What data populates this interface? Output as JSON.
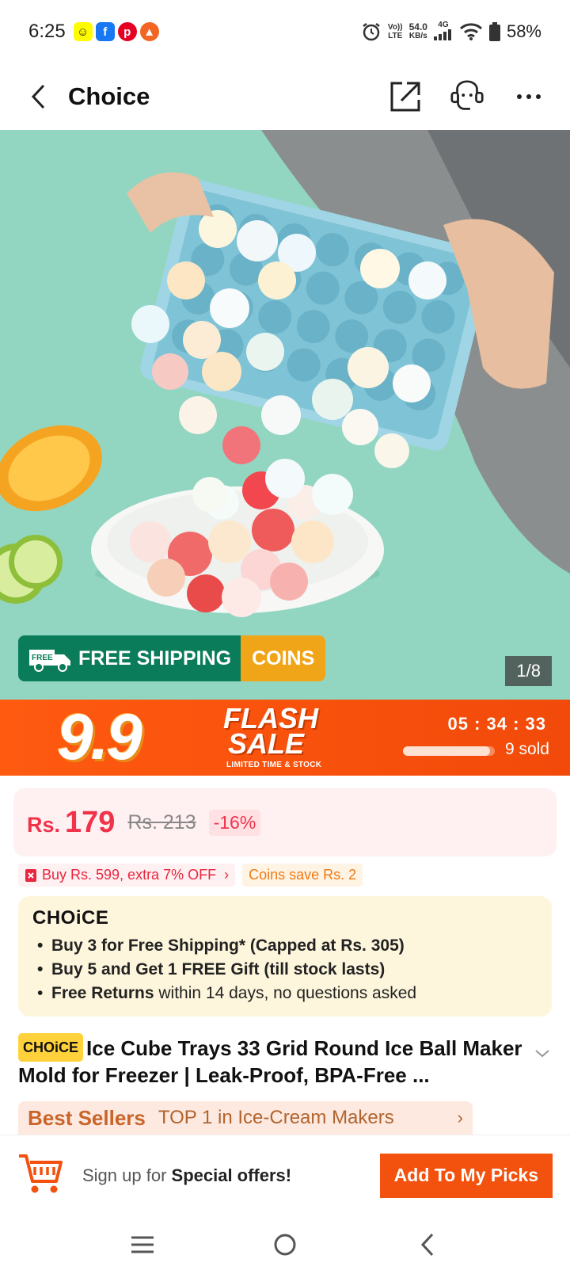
{
  "status_bar": {
    "time": "6:25",
    "net_speed": "54.0",
    "net_unit": "KB/s",
    "volte": "Vo))",
    "lte": "LTE",
    "network": "4G",
    "battery": "58%"
  },
  "header": {
    "title": "Choice"
  },
  "hero": {
    "free_label": "FREE",
    "shipping_label": "FREE SHIPPING",
    "coins_label": "COINS",
    "image_counter": "1/8"
  },
  "flash_sale": {
    "badge": "9.9",
    "title_line1": "FLASH",
    "title_line2": "SALE",
    "subtitle": "LIMITED TIME & STOCK",
    "timer": "05 : 34 : 33",
    "sold": "9 sold",
    "sold_progress": 0.95
  },
  "price": {
    "currency": "Rs.",
    "current": "179",
    "original": "Rs. 213",
    "discount": "-16%"
  },
  "promos": {
    "extra_off": "Buy Rs. 599, extra 7% OFF",
    "coins_save": "Coins save Rs. 2"
  },
  "choice_box": {
    "logo": "CHOiCE",
    "line1": "Buy 3 for  Free Shipping* (Capped at Rs. 305)",
    "line2": "Buy 5 and Get 1 FREE Gift (till stock lasts)",
    "line3_bold": "Free Returns",
    "line3_rest": " within 14 days, no questions asked"
  },
  "product": {
    "badge": "CHOiCE",
    "title": "Ice Cube Trays 33 Grid Round Ice Ball Maker Mold for Freezer | Leak-Proof, BPA-Free ..."
  },
  "bestseller": {
    "label": "Best Sellers",
    "text": "TOP 1 in Ice-Cream Makers"
  },
  "bottom_bar": {
    "signup_prefix": "Sign up for ",
    "signup_bold": "Special offers!",
    "add_button": "Add To My Picks"
  },
  "colors": {
    "accent": "#f2520d",
    "price_red": "#f0334b",
    "choice_yellow": "#ffd23c",
    "shipping_green": "#0a7c5a"
  }
}
